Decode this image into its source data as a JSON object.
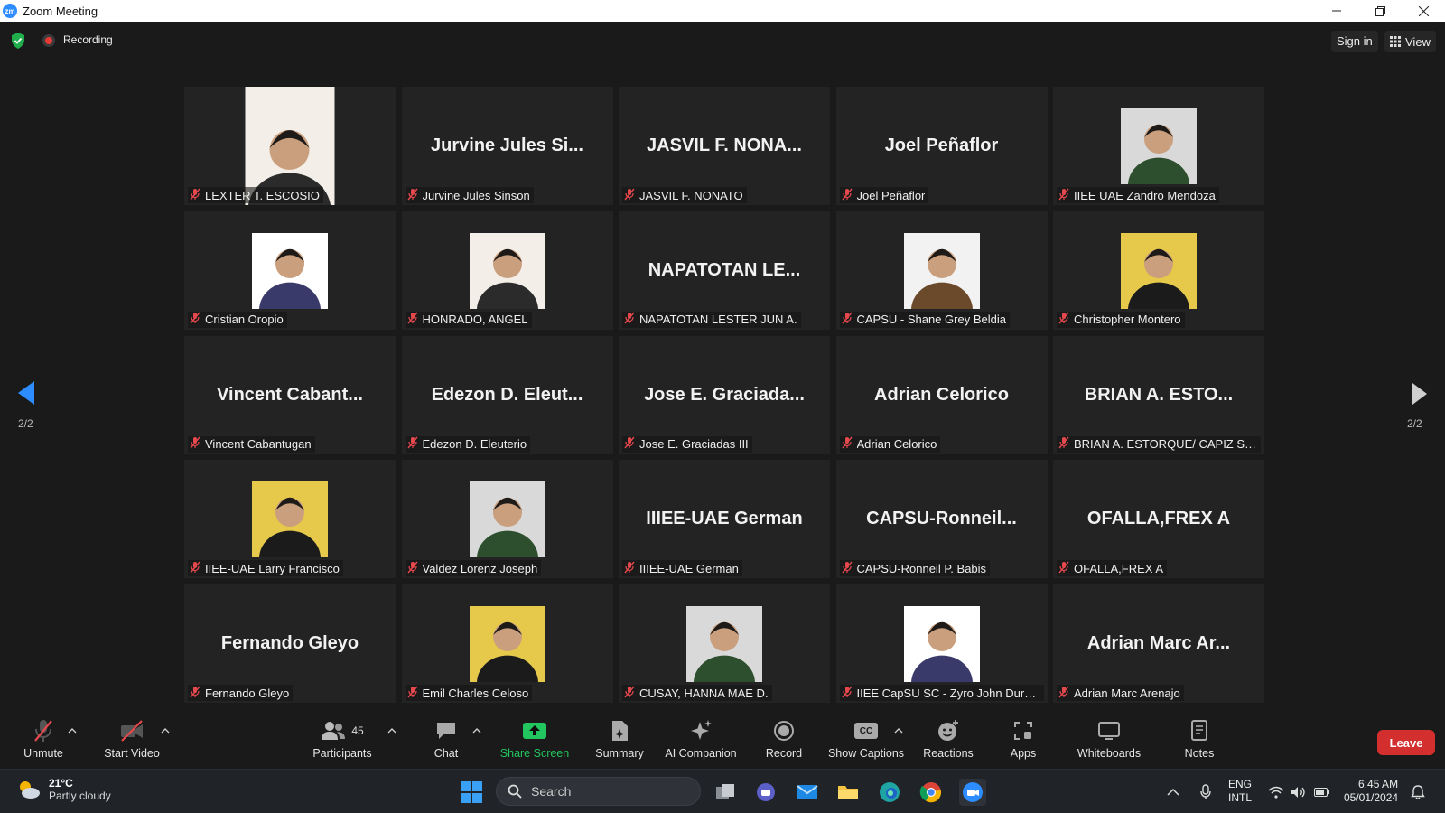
{
  "window": {
    "title": "Zoom Meeting",
    "logo_text": "zm"
  },
  "topbar": {
    "recording_label": "Recording",
    "signin_label": "Sign in",
    "view_label": "View"
  },
  "pagination": {
    "left_page": "2/2",
    "right_page": "2/2"
  },
  "tiles": [
    {
      "label": "LEXTER T. ESCOSIO",
      "big": "",
      "photo": "tall"
    },
    {
      "label": "Jurvine Jules Sinson",
      "big": "Jurvine Jules Si...",
      "photo": ""
    },
    {
      "label": "JASVIL F. NONATO",
      "big": "JASVIL F. NONA...",
      "photo": ""
    },
    {
      "label": "Joel Peñaflor",
      "big": "Joel Peñaflor",
      "photo": ""
    },
    {
      "label": "IIEE UAE Zandro Mendoza",
      "big": "",
      "photo": "square"
    },
    {
      "label": "Cristian Oropio",
      "big": "",
      "photo": "square"
    },
    {
      "label": "HONRADO, ANGEL",
      "big": "",
      "photo": "square"
    },
    {
      "label": "NAPATOTAN LESTER JUN A.",
      "big": "NAPATOTAN  LE...",
      "photo": ""
    },
    {
      "label": "CAPSU - Shane Grey Beldia",
      "big": "",
      "photo": "square"
    },
    {
      "label": "Christopher Montero",
      "big": "",
      "photo": "square"
    },
    {
      "label": "Vincent Cabantugan",
      "big": "Vincent Cabant...",
      "photo": ""
    },
    {
      "label": "Edezon D. Eleuterio",
      "big": "Edezon D. Eleut...",
      "photo": ""
    },
    {
      "label": "Jose E. Graciadas III",
      "big": "Jose E. Graciada...",
      "photo": ""
    },
    {
      "label": "Adrian Celorico",
      "big": "Adrian Celorico",
      "photo": ""
    },
    {
      "label": "BRIAN A. ESTORQUE/ CAPIZ STAT...",
      "big": "BRIAN A. ESTO...",
      "photo": ""
    },
    {
      "label": "IIEE-UAE Larry Francisco",
      "big": "",
      "photo": "square"
    },
    {
      "label": "Valdez Lorenz Joseph",
      "big": "",
      "photo": "square"
    },
    {
      "label": "IIIEE-UAE German",
      "big": "IIIEE-UAE German",
      "photo": ""
    },
    {
      "label": "CAPSU-Ronneil P. Babis",
      "big": "CAPSU-Ronneil...",
      "photo": ""
    },
    {
      "label": "OFALLA,FREX A",
      "big": "OFALLA,FREX A",
      "photo": ""
    },
    {
      "label": "Fernando Gleyo",
      "big": "Fernando Gleyo",
      "photo": ""
    },
    {
      "label": "Emil Charles Celoso",
      "big": "",
      "photo": "square"
    },
    {
      "label": "CUSAY, HANNA MAE D.",
      "big": "",
      "photo": "square"
    },
    {
      "label": "IIEE CapSU SC - Zyro John Durana",
      "big": "",
      "photo": "square"
    },
    {
      "label": "Adrian Marc Arenajo",
      "big": "Adrian Marc Ar...",
      "photo": ""
    }
  ],
  "toolbar": {
    "unmute": "Unmute",
    "start_video": "Start Video",
    "participants": "Participants",
    "participant_count": "45",
    "chat": "Chat",
    "share_screen": "Share Screen",
    "summary": "Summary",
    "ai_companion": "AI Companion",
    "record": "Record",
    "show_captions": "Show Captions",
    "captions_icon_text": "CC",
    "reactions": "Reactions",
    "apps": "Apps",
    "whiteboards": "Whiteboards",
    "notes": "Notes",
    "leave": "Leave"
  },
  "taskbar": {
    "weather_temp": "21°C",
    "weather_desc": "Partly cloudy",
    "search_placeholder": "Search",
    "lang_line1": "ENG",
    "lang_line2": "INTL",
    "time": "6:45 AM",
    "date": "05/01/2024"
  },
  "colors": {
    "accent": "#2d8cff",
    "share_green": "#22c55e",
    "leave_red": "#d32f2f",
    "muted_red": "#e5484d"
  }
}
